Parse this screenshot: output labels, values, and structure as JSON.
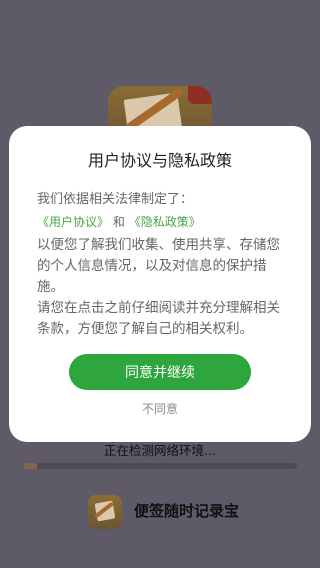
{
  "dialog": {
    "title": "用户协议与隐私政策",
    "intro": "我们依据相关法律制定了：",
    "user_agreement": "《用户协议》",
    "and": "和",
    "privacy_policy": "《隐私政策》",
    "body_1": "以便您了解我们收集、使用共享、存储您的个人信息情况，以及对信息的保护措施。",
    "body_2": "请您在点击之前仔细阅读并充分理解相关条款，方便您了解自己的相关权利。",
    "agree_button": "同意并继续",
    "disagree_button": "不同意"
  },
  "loading": {
    "status": "正在检测网络环境...",
    "progress": 0.05
  },
  "app": {
    "name": "便签随时记录宝"
  },
  "colors": {
    "overlay": "#5f5a68",
    "accent": "#2ea63d",
    "link": "#4aa64a"
  },
  "icons": {
    "background_logo": "note-pen-icon",
    "bottom_logo": "note-pen-icon"
  }
}
